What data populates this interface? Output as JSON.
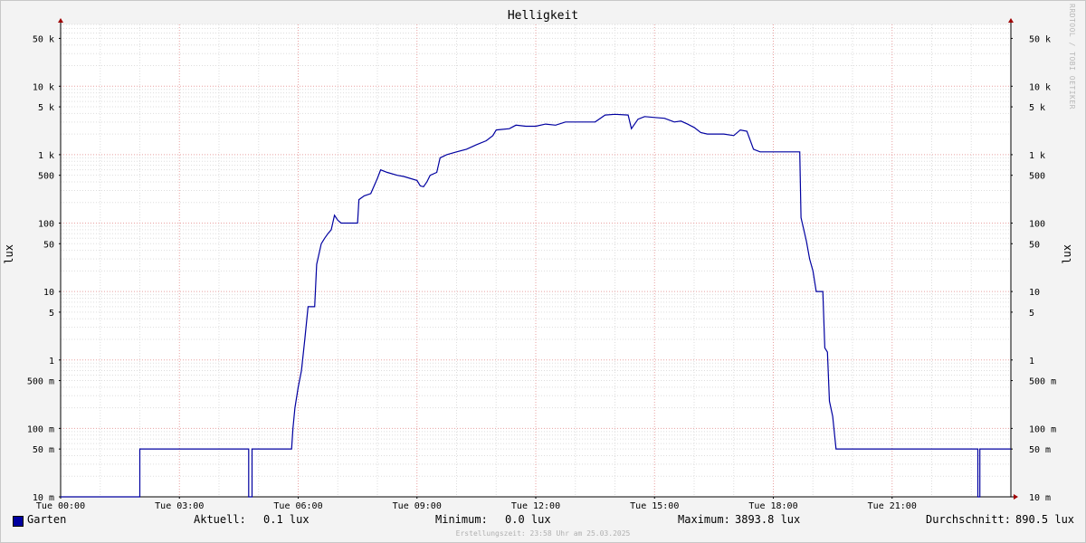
{
  "chart_data": {
    "type": "line",
    "title": "Helligkeit",
    "ylabel": "lux",
    "yscale": "log",
    "ylim": [
      0.01,
      80000
    ],
    "xlim": [
      "00:00",
      "24:00"
    ],
    "x_ticks": [
      "Tue 00:00",
      "Tue 03:00",
      "Tue 06:00",
      "Tue 09:00",
      "Tue 12:00",
      "Tue 15:00",
      "Tue 18:00",
      "Tue 21:00"
    ],
    "y_ticks": [
      {
        "value": 0.01,
        "label": "10 m"
      },
      {
        "value": 0.05,
        "label": "50 m"
      },
      {
        "value": 0.1,
        "label": "100 m"
      },
      {
        "value": 0.5,
        "label": "500 m"
      },
      {
        "value": 1,
        "label": "1"
      },
      {
        "value": 5,
        "label": "5"
      },
      {
        "value": 10,
        "label": "10"
      },
      {
        "value": 50,
        "label": "50"
      },
      {
        "value": 100,
        "label": "100"
      },
      {
        "value": 500,
        "label": "500"
      },
      {
        "value": 1000,
        "label": "1 k"
      },
      {
        "value": 5000,
        "label": "5 k"
      },
      {
        "value": 10000,
        "label": "10 k"
      },
      {
        "value": 50000,
        "label": "50 k"
      }
    ],
    "grid": true,
    "series": [
      {
        "name": "Garten",
        "color": "#0000a0",
        "points": [
          [
            "00:00",
            0.01
          ],
          [
            "02:00",
            0.01
          ],
          [
            "02:00",
            0.05
          ],
          [
            "04:45",
            0.05
          ],
          [
            "04:45",
            0.01
          ],
          [
            "04:50",
            0.01
          ],
          [
            "04:50",
            0.05
          ],
          [
            "05:50",
            0.05
          ],
          [
            "05:52",
            0.1
          ],
          [
            "05:55",
            0.2
          ],
          [
            "06:00",
            0.4
          ],
          [
            "06:05",
            0.7
          ],
          [
            "06:10",
            2
          ],
          [
            "06:15",
            6
          ],
          [
            "06:25",
            6
          ],
          [
            "06:28",
            25
          ],
          [
            "06:35",
            50
          ],
          [
            "06:40",
            60
          ],
          [
            "06:45",
            70
          ],
          [
            "06:50",
            80
          ],
          [
            "06:55",
            130
          ],
          [
            "07:00",
            110
          ],
          [
            "07:05",
            100
          ],
          [
            "07:30",
            100
          ],
          [
            "07:32",
            220
          ],
          [
            "07:40",
            250
          ],
          [
            "07:50",
            270
          ],
          [
            "08:00",
            450
          ],
          [
            "08:05",
            600
          ],
          [
            "08:15",
            550
          ],
          [
            "08:30",
            500
          ],
          [
            "08:40",
            480
          ],
          [
            "09:00",
            420
          ],
          [
            "09:05",
            350
          ],
          [
            "09:10",
            340
          ],
          [
            "09:15",
            400
          ],
          [
            "09:20",
            500
          ],
          [
            "09:30",
            550
          ],
          [
            "09:35",
            900
          ],
          [
            "09:45",
            1000
          ],
          [
            "10:00",
            1100
          ],
          [
            "10:15",
            1200
          ],
          [
            "10:30",
            1400
          ],
          [
            "10:45",
            1600
          ],
          [
            "10:55",
            1900
          ],
          [
            "11:00",
            2300
          ],
          [
            "11:20",
            2400
          ],
          [
            "11:30",
            2700
          ],
          [
            "11:45",
            2600
          ],
          [
            "12:00",
            2600
          ],
          [
            "12:15",
            2800
          ],
          [
            "12:30",
            2700
          ],
          [
            "12:45",
            3000
          ],
          [
            "13:00",
            3000
          ],
          [
            "13:15",
            3000
          ],
          [
            "13:30",
            3000
          ],
          [
            "13:45",
            3800
          ],
          [
            "14:00",
            3894
          ],
          [
            "14:20",
            3800
          ],
          [
            "14:25",
            2400
          ],
          [
            "14:35",
            3300
          ],
          [
            "14:45",
            3600
          ],
          [
            "15:00",
            3500
          ],
          [
            "15:15",
            3400
          ],
          [
            "15:30",
            3000
          ],
          [
            "15:40",
            3100
          ],
          [
            "15:50",
            2800
          ],
          [
            "16:00",
            2500
          ],
          [
            "16:10",
            2100
          ],
          [
            "16:20",
            2000
          ],
          [
            "16:30",
            2000
          ],
          [
            "16:45",
            2000
          ],
          [
            "17:00",
            1900
          ],
          [
            "17:10",
            2300
          ],
          [
            "17:20",
            2200
          ],
          [
            "17:30",
            1200
          ],
          [
            "17:40",
            1100
          ],
          [
            "18:00",
            1100
          ],
          [
            "18:15",
            1100
          ],
          [
            "18:30",
            1100
          ],
          [
            "18:40",
            1100
          ],
          [
            "18:42",
            120
          ],
          [
            "18:45",
            90
          ],
          [
            "18:50",
            55
          ],
          [
            "18:55",
            30
          ],
          [
            "19:00",
            20
          ],
          [
            "19:05",
            10
          ],
          [
            "19:15",
            10
          ],
          [
            "19:18",
            1.5
          ],
          [
            "19:22",
            1.3
          ],
          [
            "19:25",
            0.25
          ],
          [
            "19:30",
            0.15
          ],
          [
            "19:35",
            0.05
          ],
          [
            "23:10",
            0.05
          ],
          [
            "23:10",
            0.01
          ],
          [
            "23:13",
            0.01
          ],
          [
            "23:13",
            0.05
          ],
          [
            "24:00",
            0.05
          ]
        ]
      }
    ],
    "legend": {
      "series_label": "Garten",
      "current_label": "Aktuell:",
      "current_value": "0.1 lux",
      "min_label": "Minimum:",
      "min_value": "0.0 lux",
      "max_label": "Maximum:",
      "max_value": "3893.8 lux",
      "avg_label": "Durchschnitt:",
      "avg_value": "890.5 lux"
    }
  },
  "footer": "Erstellungszeit: 23:58 Uhr am 25.03.2025",
  "watermark": "RRDTOOL / TOBI OETIKER"
}
